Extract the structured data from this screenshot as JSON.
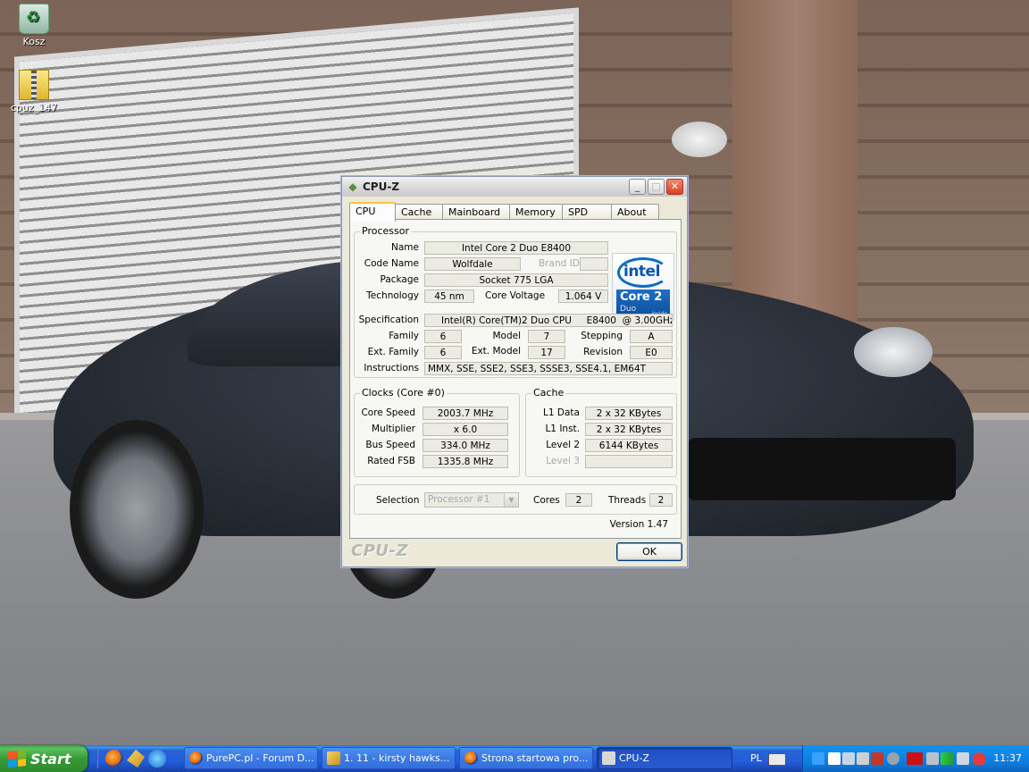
{
  "desktop": {
    "icons": [
      {
        "label": "Kosz",
        "icon": "recycle-bin-icon"
      },
      {
        "label": "cpuz_147",
        "icon": "zip-folder-icon"
      }
    ]
  },
  "window": {
    "title": "CPU-Z",
    "controls": {
      "minimize": "_",
      "maximize": "□",
      "close": "✕"
    },
    "tabs": [
      {
        "label": "CPU",
        "active": true
      },
      {
        "label": "Cache"
      },
      {
        "label": "Mainboard"
      },
      {
        "label": "Memory"
      },
      {
        "label": "SPD"
      },
      {
        "label": "About"
      }
    ],
    "processor": {
      "legend": "Processor",
      "name_label": "Name",
      "name": "Intel Core 2 Duo E8400",
      "codename_label": "Code Name",
      "codename": "Wolfdale",
      "brandid_label": "Brand ID",
      "brandid": "",
      "package_label": "Package",
      "package": "Socket 775 LGA",
      "technology_label": "Technology",
      "technology": "45 nm",
      "voltage_label": "Core Voltage",
      "voltage": "1.064 V",
      "spec_label": "Specification",
      "spec": "Intel(R) Core(TM)2 Duo CPU     E8400  @ 3.00GHz",
      "family_label": "Family",
      "family": "6",
      "model_label": "Model",
      "model": "7",
      "stepping_label": "Stepping",
      "stepping": "A",
      "extfamily_label": "Ext. Family",
      "extfamily": "6",
      "extmodel_label": "Ext. Model",
      "extmodel": "17",
      "revision_label": "Revision",
      "revision": "E0",
      "instructions_label": "Instructions",
      "instructions": "MMX, SSE, SSE2, SSE3, SSSE3, SSE4.1, EM64T",
      "logo": {
        "brand": "intel",
        "line1": "Core 2",
        "line2": "Duo",
        "line3": "inside"
      }
    },
    "clocks": {
      "legend": "Clocks (Core #0)",
      "core_speed_label": "Core Speed",
      "core_speed": "2003.7 MHz",
      "multiplier_label": "Multiplier",
      "multiplier": "x 6.0",
      "bus_speed_label": "Bus Speed",
      "bus_speed": "334.0 MHz",
      "rated_fsb_label": "Rated FSB",
      "rated_fsb": "1335.8 MHz"
    },
    "cache": {
      "legend": "Cache",
      "l1data_label": "L1 Data",
      "l1data": "2 x 32 KBytes",
      "l1inst_label": "L1 Inst.",
      "l1inst": "2 x 32 KBytes",
      "level2_label": "Level 2",
      "level2": "6144 KBytes",
      "level3_label": "Level 3",
      "level3": ""
    },
    "selection": {
      "label": "Selection",
      "value": "Processor #1",
      "cores_label": "Cores",
      "cores": "2",
      "threads_label": "Threads",
      "threads": "2"
    },
    "version": "Version 1.47",
    "footer_logo": "CPU-Z",
    "ok_label": "OK"
  },
  "taskbar": {
    "start_label": "Start",
    "quicklaunch": [
      "firefox-icon",
      "winamp-icon",
      "ie-icon"
    ],
    "buttons": [
      {
        "label": "PurePC.pl - Forum D...",
        "icon": "firefox-icon"
      },
      {
        "label": "1. 11 - kirsty hawks...",
        "icon": "winamp-icon"
      },
      {
        "label": "Strona startowa pro...",
        "icon": "firefox-icon"
      },
      {
        "label": "CPU-Z",
        "icon": "cpuz-icon",
        "active": true
      }
    ],
    "language": "PL",
    "clock": "11:37"
  }
}
